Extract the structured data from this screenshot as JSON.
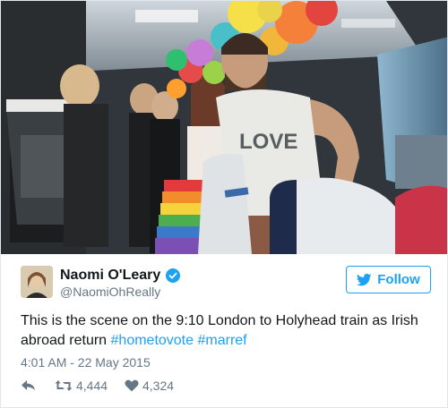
{
  "author": {
    "name": "Naomi O'Leary",
    "handle": "@NaomiOhReally",
    "verified": true
  },
  "follow": {
    "label": "Follow",
    "icon": "twitter-bird-icon"
  },
  "tweet": {
    "text_intro": "This is the scene on the 9:10 London to Holyhead train as Irish abroad return",
    "hashtags": [
      "#hometovote",
      "#marref"
    ],
    "timestamp": "4:01 AM - 22 May 2015"
  },
  "photo": {
    "description_icon": "photo-icon",
    "shirt_text": "LOVE"
  },
  "actions": {
    "reply_icon": "reply-icon",
    "retweet_icon": "retweet-icon",
    "retweet_count": "4,444",
    "like_icon": "heart-icon",
    "like_count": "4,324"
  },
  "colors": {
    "accent": "#1da1f2",
    "text": "#14171a",
    "muted": "#657786",
    "border": "#e1e8ed"
  }
}
